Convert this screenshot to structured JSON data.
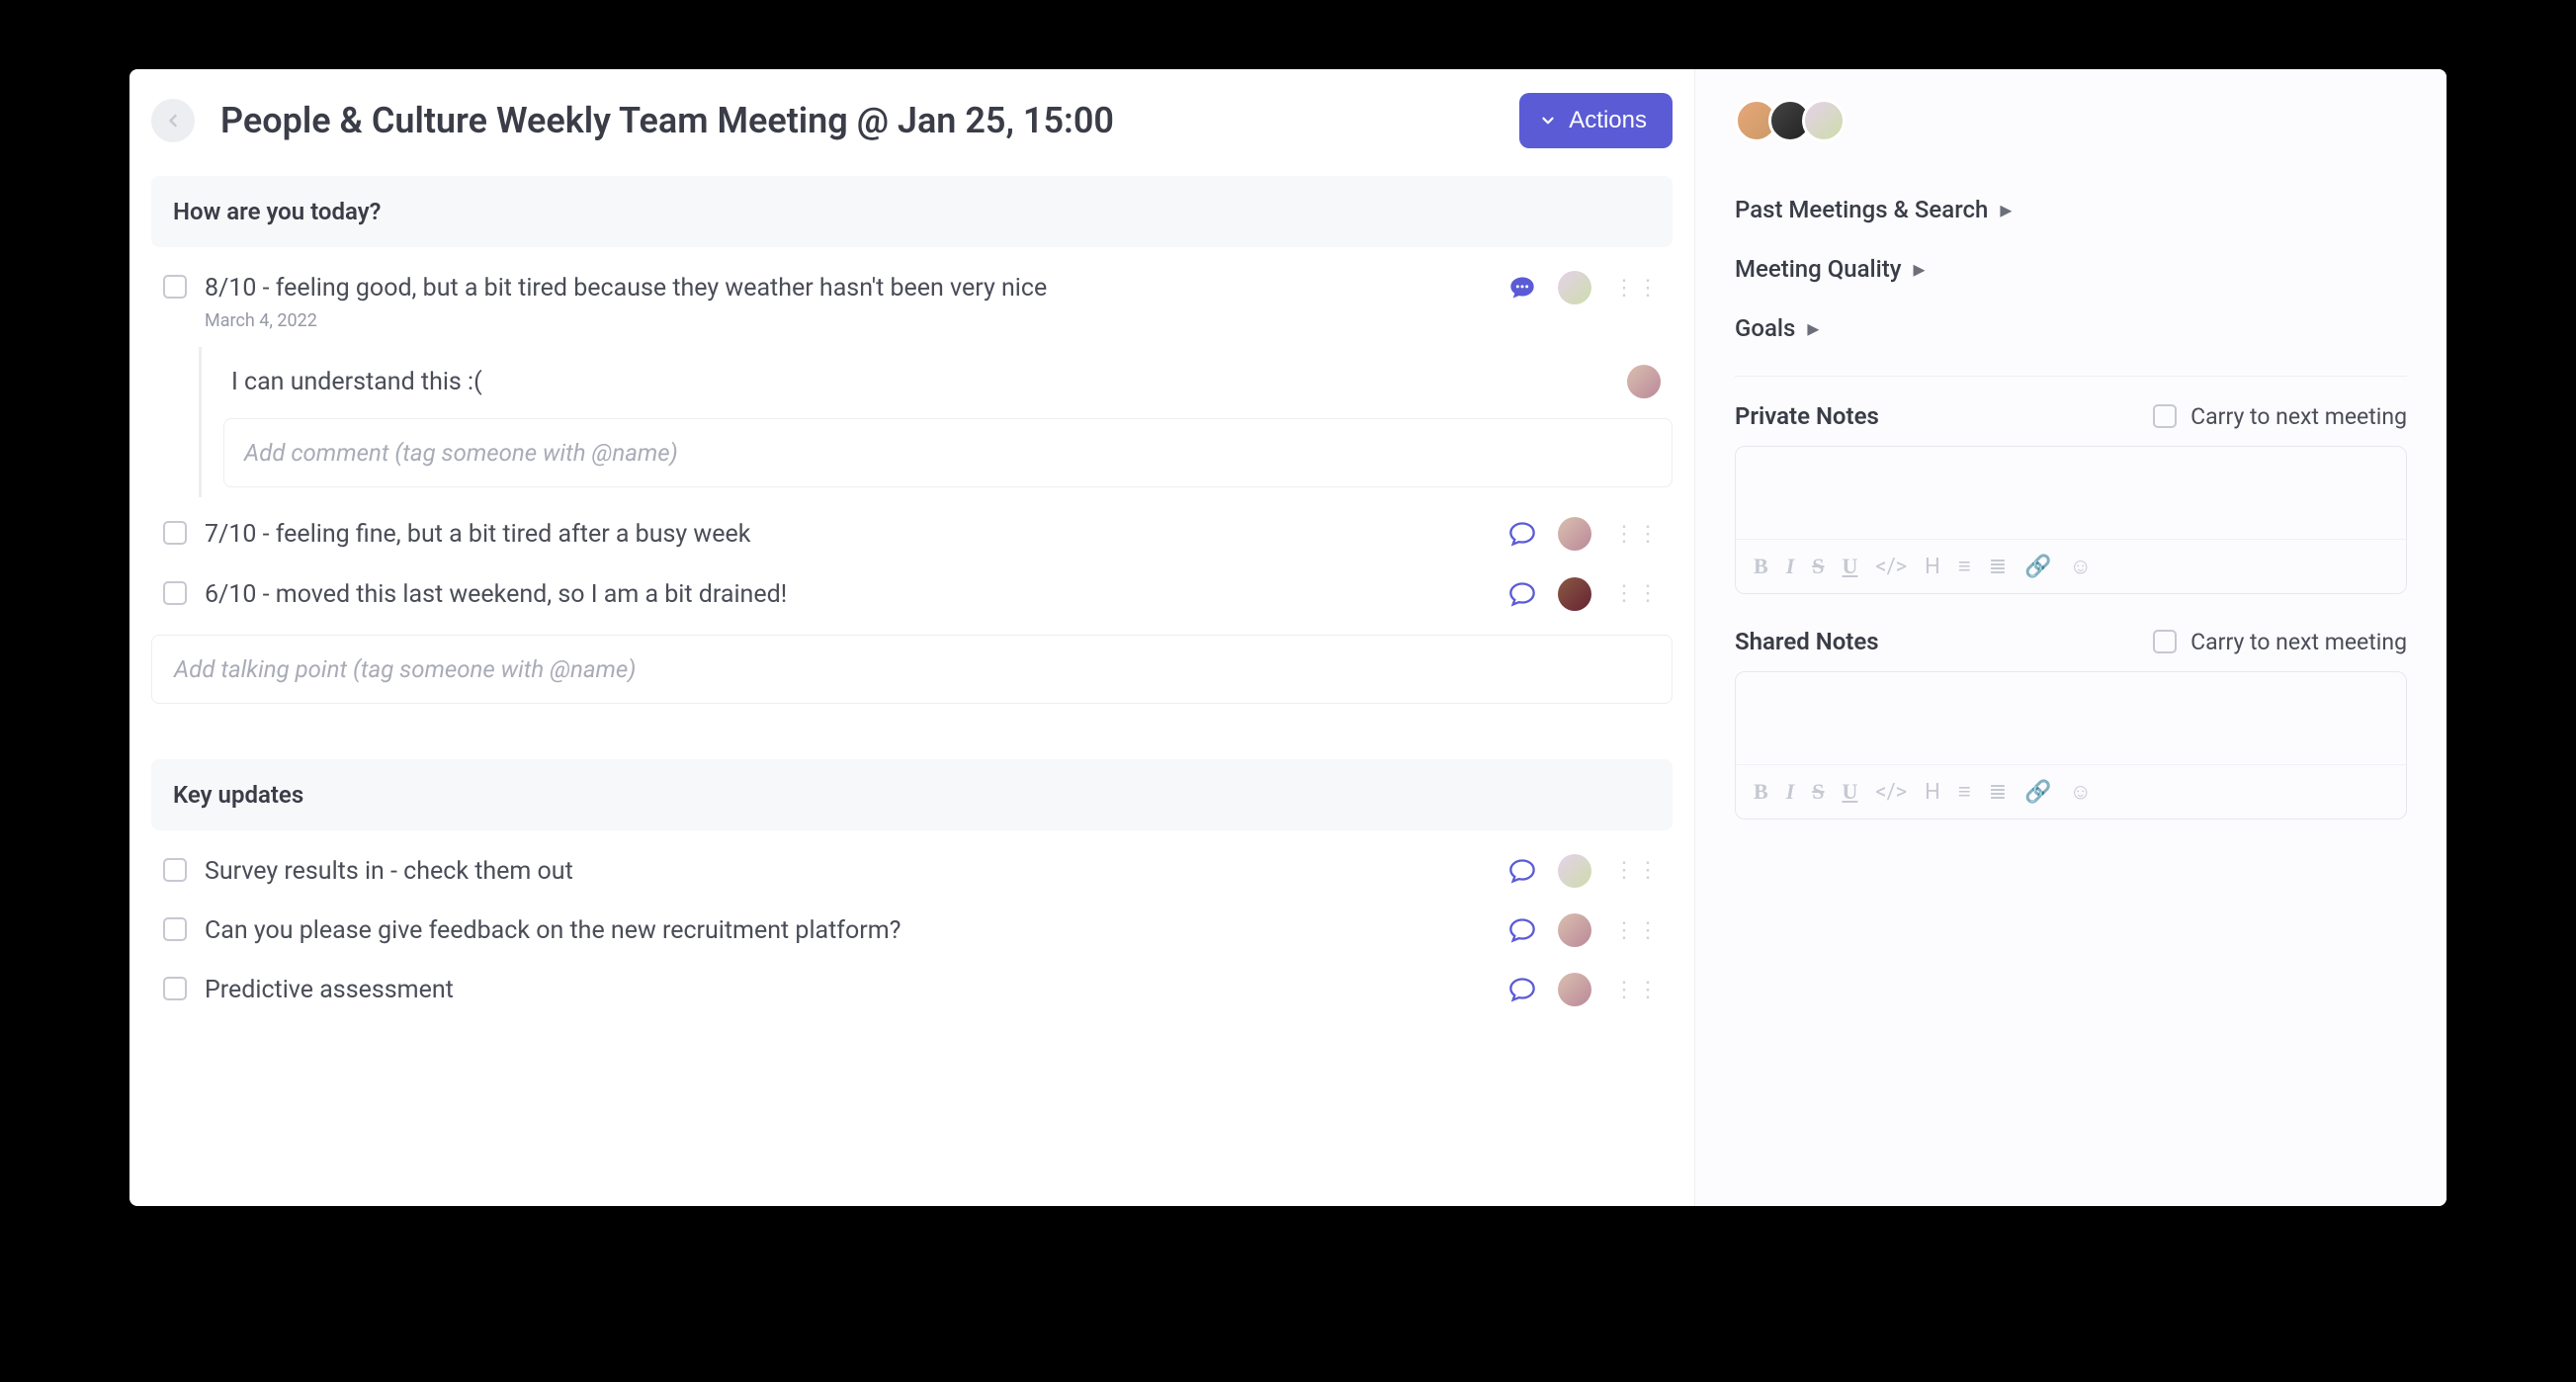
{
  "header": {
    "title": "People & Culture Weekly Team Meeting @ Jan 25, 15:00",
    "actions_label": "Actions"
  },
  "sections": [
    {
      "title": "How are you today?",
      "items": [
        {
          "text": "8/10 - feeling good, but a bit tired because they weather hasn't been very nice",
          "date": "March 4, 2022",
          "comment_filled": true,
          "avatar": "av-c",
          "thread": {
            "reply_text": "I can understand this :(",
            "reply_avatar": "av-d",
            "input_placeholder": "Add comment (tag someone with @name)"
          }
        },
        {
          "text": "7/10 - feeling fine, but a bit tired after a busy week",
          "comment_filled": false,
          "avatar": "av-d"
        },
        {
          "text": "6/10 - moved this last weekend, so I am a bit drained!",
          "comment_filled": false,
          "avatar": "av-e"
        }
      ],
      "add_placeholder": "Add talking point (tag someone with @name)"
    },
    {
      "title": "Key updates",
      "items": [
        {
          "text": "Survey results in - check them out",
          "comment_filled": false,
          "avatar": "av-c"
        },
        {
          "text": "Can you please give feedback on the new recruitment platform?",
          "comment_filled": false,
          "avatar": "av-d"
        },
        {
          "text": "Predictive assessment",
          "comment_filled": false,
          "avatar": "av-d"
        }
      ]
    }
  ],
  "side": {
    "avatars": [
      "av-a",
      "av-b",
      "av-c"
    ],
    "links": [
      "Past Meetings & Search",
      "Meeting Quality",
      "Goals"
    ],
    "private_notes": {
      "title": "Private Notes",
      "carry_label": "Carry to next meeting"
    },
    "shared_notes": {
      "title": "Shared Notes",
      "carry_label": "Carry to next meeting"
    }
  }
}
